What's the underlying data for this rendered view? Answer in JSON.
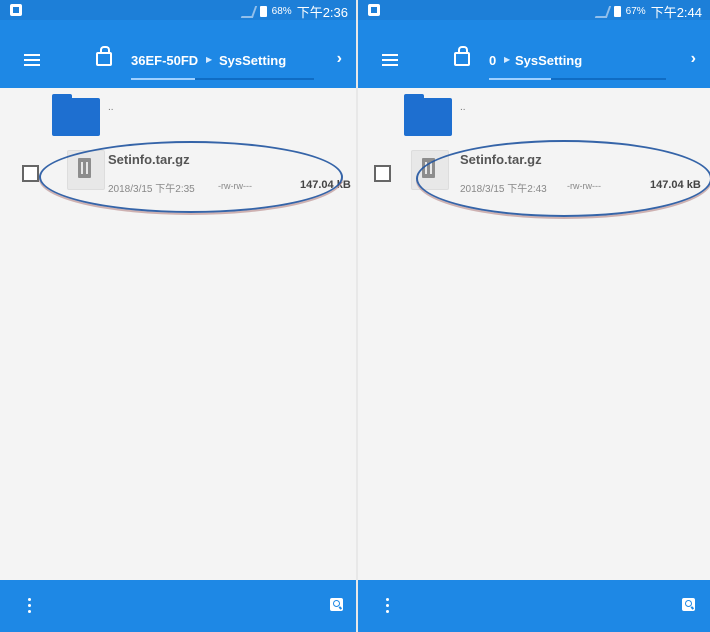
{
  "left": {
    "status": {
      "battery": "68%",
      "time": "下午2:36"
    },
    "breadcrumb": {
      "device": "36EF-50FD",
      "folder": "SysSetting"
    },
    "parent_label": "..",
    "file": {
      "name": "Setinfo.tar.gz",
      "date": "2018/3/15 下午2:35",
      "perms": "-rw-rw---",
      "size": "147.04 kB"
    }
  },
  "right": {
    "status": {
      "battery": "67%",
      "time": "下午2:44"
    },
    "breadcrumb": {
      "device": "0",
      "folder": "SysSetting"
    },
    "parent_label": "..",
    "file": {
      "name": "Setinfo.tar.gz",
      "date": "2018/3/15 下午2:43",
      "perms": "-rw-rw---",
      "size": "147.04 kB"
    }
  }
}
